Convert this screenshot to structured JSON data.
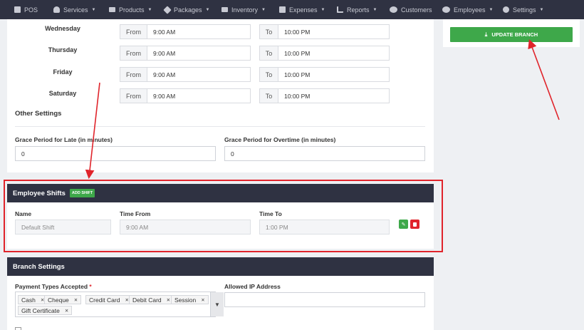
{
  "nav": [
    {
      "label": "POS",
      "icon": "pos-icon",
      "caret": false
    },
    {
      "label": "Services",
      "icon": "services-icon",
      "caret": true
    },
    {
      "label": "Products",
      "icon": "truck-icon",
      "caret": true
    },
    {
      "label": "Packages",
      "icon": "tag-icon",
      "caret": true
    },
    {
      "label": "Inventory",
      "icon": "inventory-icon",
      "caret": true
    },
    {
      "label": "Expenses",
      "icon": "expenses-icon",
      "caret": true
    },
    {
      "label": "Reports",
      "icon": "bar-chart-icon",
      "caret": true
    },
    {
      "label": "Customers",
      "icon": "users-icon",
      "caret": false
    },
    {
      "label": "Employees",
      "icon": "employees-icon",
      "caret": true
    },
    {
      "label": "Settings",
      "icon": "gear-icon",
      "caret": true
    }
  ],
  "schedule": {
    "from_label": "From",
    "to_label": "To",
    "days": [
      {
        "day": "Wednesday",
        "from": "9:00 AM",
        "to": "10:00 PM"
      },
      {
        "day": "Thursday",
        "from": "9:00 AM",
        "to": "10:00 PM"
      },
      {
        "day": "Friday",
        "from": "9:00 AM",
        "to": "10:00 PM"
      },
      {
        "day": "Saturday",
        "from": "9:00 AM",
        "to": "10:00 PM"
      }
    ]
  },
  "other_settings": {
    "title": "Other Settings",
    "grace_late_label": "Grace Period for Late (in minutes)",
    "grace_late_value": "0",
    "grace_overtime_label": "Grace Period for Overtime (in minutes)",
    "grace_overtime_value": "0"
  },
  "shifts": {
    "title": "Employee Shifts",
    "add_label": "ADD SHIFT",
    "col_name": "Name",
    "col_from": "Time From",
    "col_to": "Time To",
    "rows": [
      {
        "name": "Default Shift",
        "from": "9:00 AM",
        "to": "1:00 PM"
      }
    ]
  },
  "branch": {
    "title": "Branch Settings",
    "payment_label": "Payment Types Accepted",
    "required_mark": "*",
    "payment_tags": [
      "Cash",
      "Cheque",
      "Credit Card",
      "Debit Card",
      "Session",
      "Gift Certificate"
    ],
    "ip_label": "Allowed IP Address",
    "ip_value": ""
  },
  "actions": {
    "update_label": "UPDATE BRANCH"
  },
  "colors": {
    "nav_bg": "#2f3242",
    "accent_green": "#3ea84a",
    "danger_red": "#e0242b",
    "annotation_red": "#e0242b"
  }
}
